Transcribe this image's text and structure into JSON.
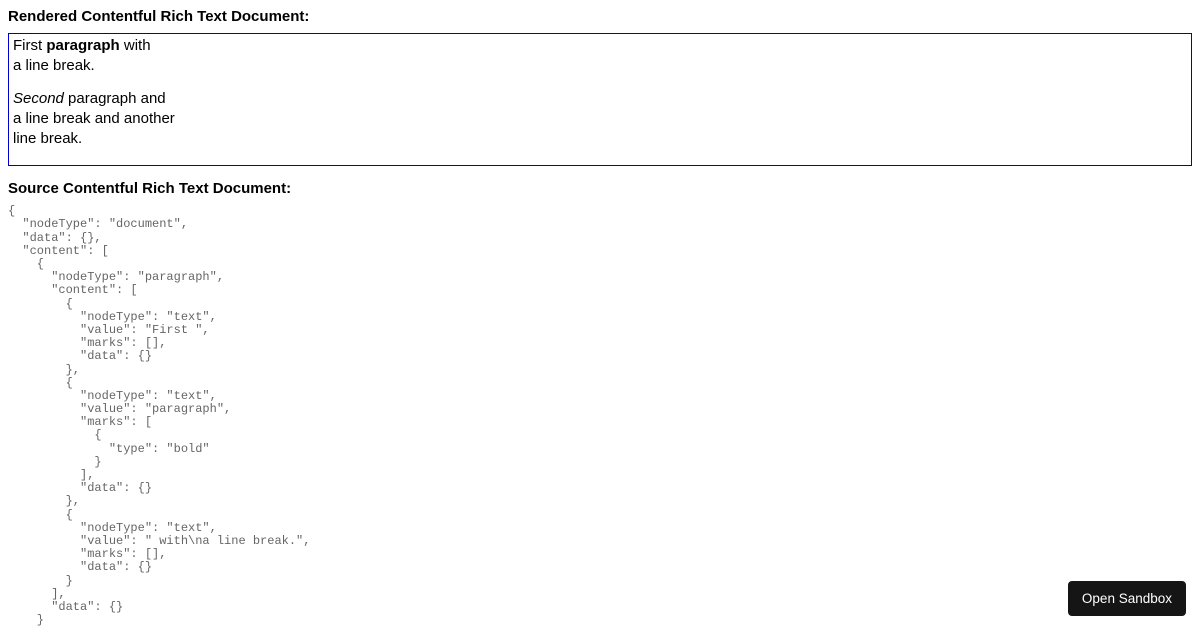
{
  "headings": {
    "rendered": "Rendered Contentful Rich Text Document:",
    "source": "Source Contentful Rich Text Document:"
  },
  "rendered": {
    "p1_text1": "First ",
    "p1_bold": "paragraph",
    "p1_text2": " with",
    "p1_line2": "a line break.",
    "p2_italic": "Second",
    "p2_text1": " paragraph and",
    "p2_line2": "a line break and another",
    "p2_line3": "line break."
  },
  "json_source": "{\n  \"nodeType\": \"document\",\n  \"data\": {},\n  \"content\": [\n    {\n      \"nodeType\": \"paragraph\",\n      \"content\": [\n        {\n          \"nodeType\": \"text\",\n          \"value\": \"First \",\n          \"marks\": [],\n          \"data\": {}\n        },\n        {\n          \"nodeType\": \"text\",\n          \"value\": \"paragraph\",\n          \"marks\": [\n            {\n              \"type\": \"bold\"\n            }\n          ],\n          \"data\": {}\n        },\n        {\n          \"nodeType\": \"text\",\n          \"value\": \" with\\na line break.\",\n          \"marks\": [],\n          \"data\": {}\n        }\n      ],\n      \"data\": {}\n    }",
  "button": {
    "open_sandbox": "Open Sandbox"
  }
}
